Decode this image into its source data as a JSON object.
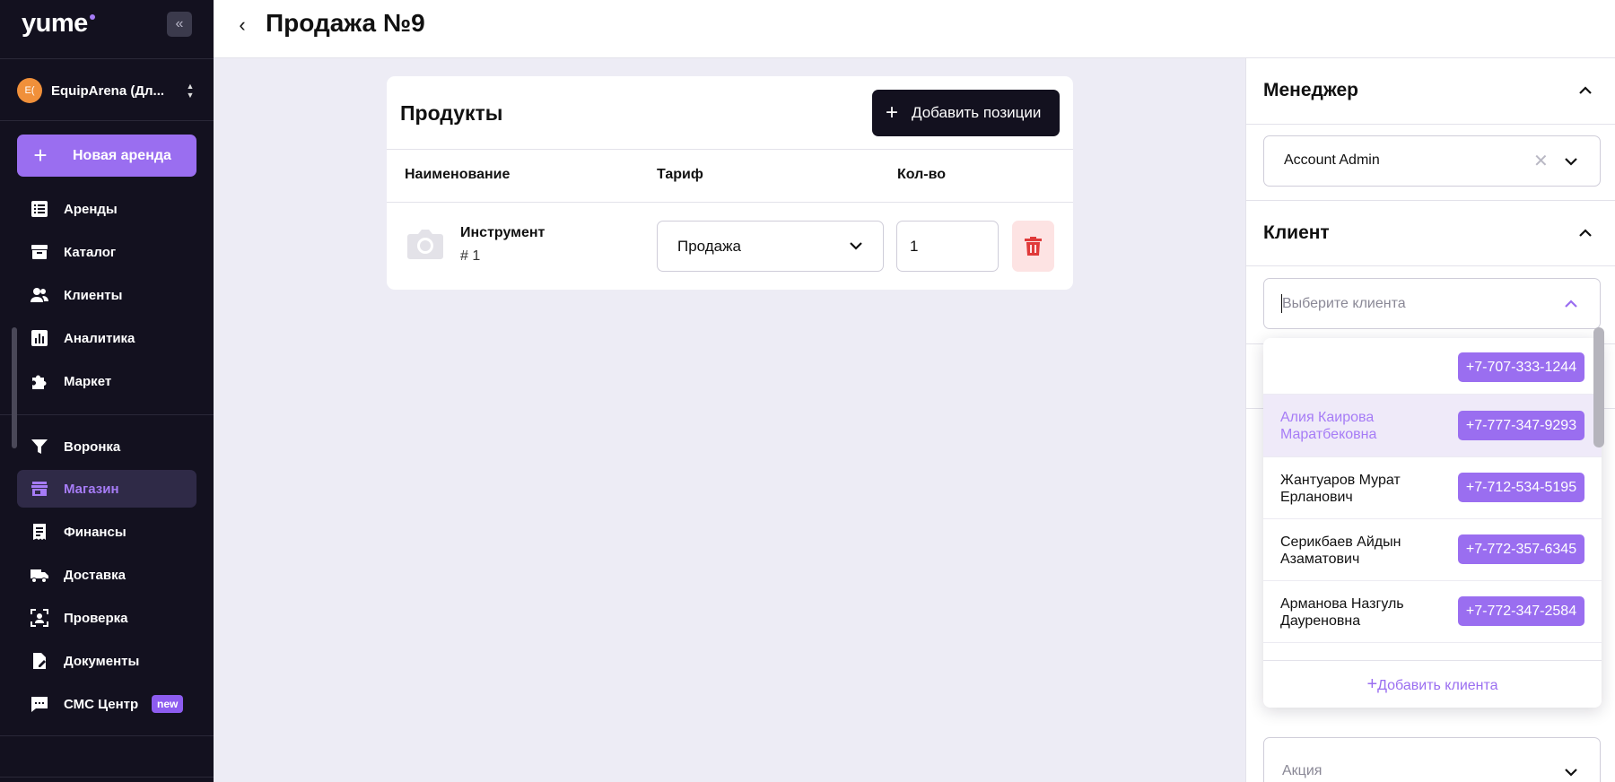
{
  "sidebar": {
    "logo": "yume",
    "company": {
      "badge": "E(",
      "name": "EquipArena (Дл..."
    },
    "new_rent_label": "Новая аренда",
    "items": [
      {
        "label": "Аренды",
        "icon": "list-icon"
      },
      {
        "label": "Каталог",
        "icon": "archive-icon"
      },
      {
        "label": "Клиенты",
        "icon": "users-icon"
      },
      {
        "label": "Аналитика",
        "icon": "chart-icon"
      },
      {
        "label": "Маркет",
        "icon": "puzzle-icon"
      },
      {
        "label": "Воронка",
        "icon": "filter-icon"
      },
      {
        "label": "Магазин",
        "icon": "store-icon",
        "active": true
      },
      {
        "label": "Финансы",
        "icon": "receipt-icon"
      },
      {
        "label": "Доставка",
        "icon": "truck-icon"
      },
      {
        "label": "Проверка",
        "icon": "face-scan-icon"
      },
      {
        "label": "Документы",
        "icon": "document-icon"
      },
      {
        "label": "СМС Центр",
        "icon": "message-icon",
        "badge": "new"
      }
    ]
  },
  "header": {
    "title": "Продажа №9"
  },
  "products": {
    "title": "Продукты",
    "add_label": "Добавить позиции",
    "columns": [
      "Наименование",
      "Тариф",
      "Кол-во"
    ],
    "rows": [
      {
        "name": "Инструмент",
        "number": "# 1",
        "tariff": "Продажа",
        "qty": "1"
      }
    ]
  },
  "right_panel": {
    "manager": {
      "title": "Менеджер",
      "value": "Account Admin"
    },
    "client": {
      "title": "Клиент",
      "placeholder": "Выберите клиента",
      "options": [
        {
          "name": "",
          "phone": "+7-707-333-1244"
        },
        {
          "name": "Алия Каирова Маратбековна",
          "phone": "+7-777-347-9293",
          "highlighted": true
        },
        {
          "name": "Жантуаров Мурат Ерланович",
          "phone": "+7-712-534-5195"
        },
        {
          "name": "Серикбаев Айдын Азаматович",
          "phone": "+7-772-357-6345"
        },
        {
          "name": "Арманова Назгуль Дауреновна",
          "phone": "+7-772-347-2584"
        }
      ],
      "add_label": "Добавить клиента"
    },
    "promo": {
      "placeholder": "Акция"
    }
  },
  "colors": {
    "accent": "#9a6ef0",
    "sidebar_bg": "#13111f",
    "page_bg": "#edecf5",
    "danger": "#e03a3a"
  }
}
